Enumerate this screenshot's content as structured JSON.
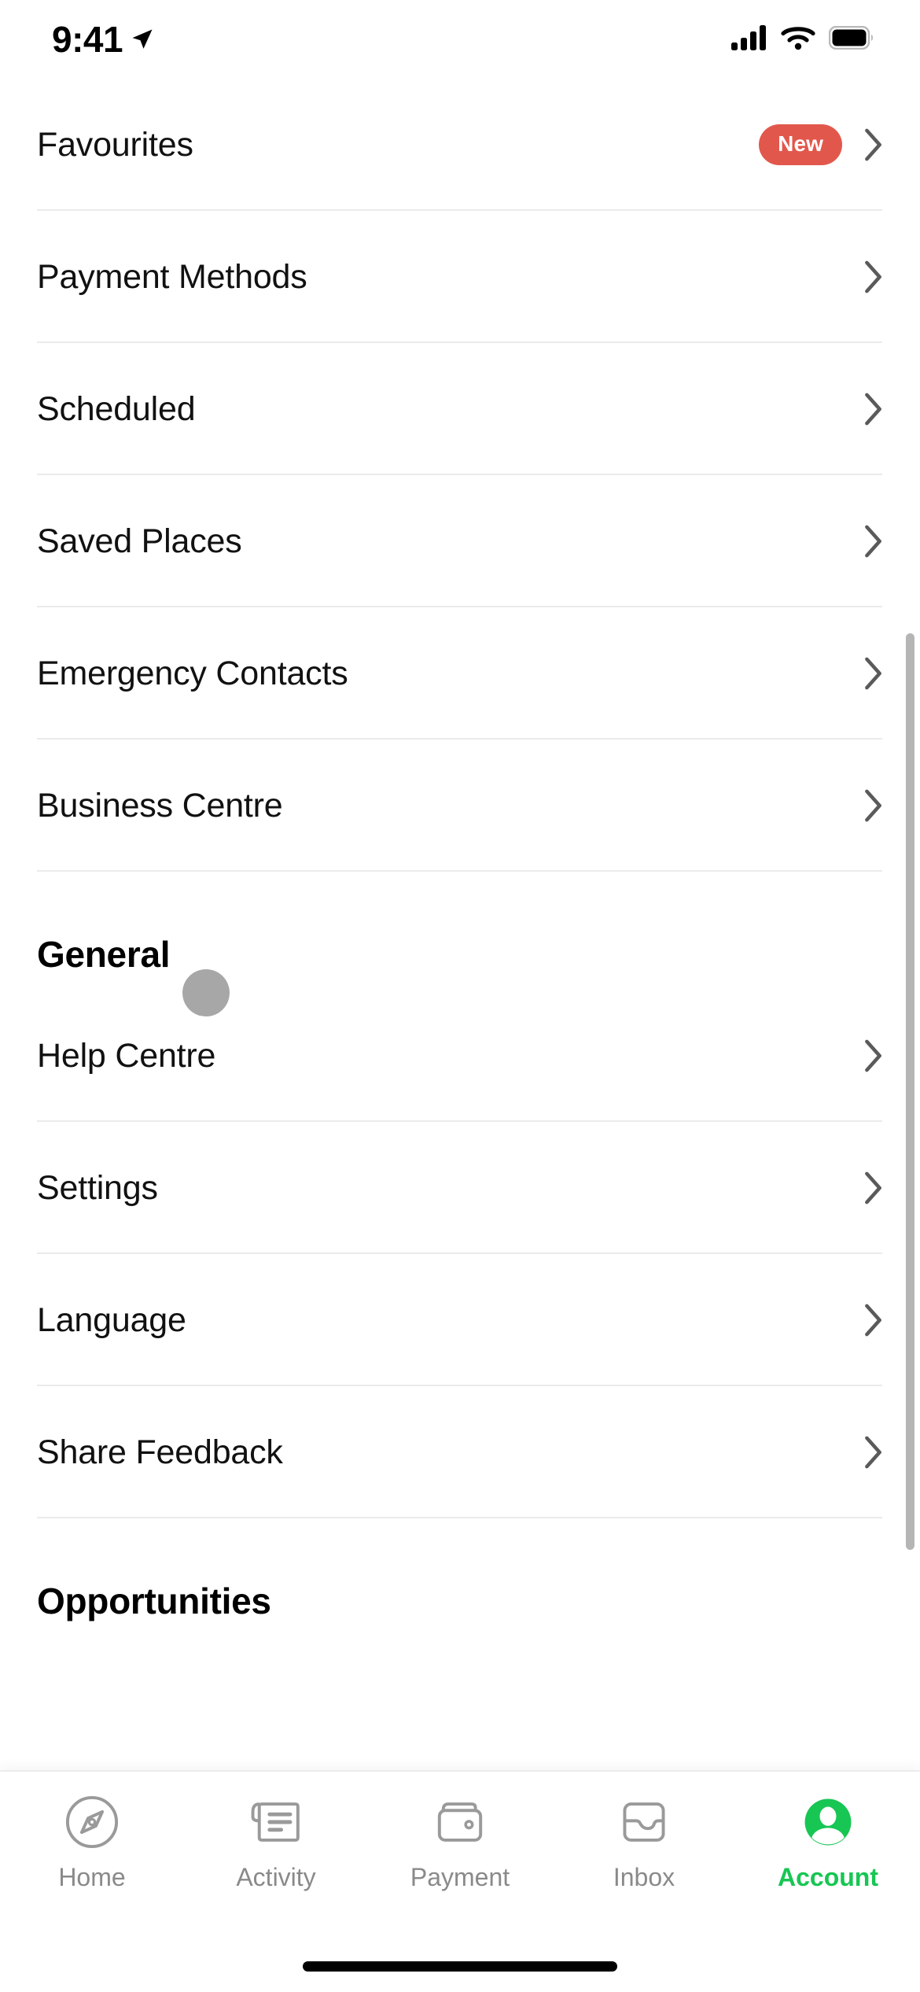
{
  "status_bar": {
    "time": "9:41",
    "location_icon": "location-arrow-icon",
    "signal_icon": "cellular-signal-icon",
    "wifi_icon": "wifi-icon",
    "battery_icon": "battery-full-icon"
  },
  "account_menu": {
    "top_rows": [
      {
        "label": "Favourites",
        "badge": "New",
        "chevron": "chevron-right-icon"
      },
      {
        "label": "Payment Methods",
        "badge": "",
        "chevron": "chevron-right-icon"
      },
      {
        "label": "Scheduled",
        "badge": "",
        "chevron": "chevron-right-icon"
      },
      {
        "label": "Saved Places",
        "badge": "",
        "chevron": "chevron-right-icon"
      },
      {
        "label": "Emergency Contacts",
        "badge": "",
        "chevron": "chevron-right-icon"
      },
      {
        "label": "Business Centre",
        "badge": "",
        "chevron": "chevron-right-icon"
      }
    ],
    "general_section": {
      "title": "General",
      "rows": [
        {
          "label": "Help Centre",
          "chevron": "chevron-right-icon"
        },
        {
          "label": "Settings",
          "chevron": "chevron-right-icon"
        },
        {
          "label": "Language",
          "chevron": "chevron-right-icon"
        },
        {
          "label": "Share Feedback",
          "chevron": "chevron-right-icon"
        }
      ]
    },
    "opportunities_section": {
      "title": "Opportunities"
    }
  },
  "badge_color": "#e2574c",
  "accent_color": "#17c653",
  "tab_bar": {
    "tabs": [
      {
        "label": "Home",
        "icon": "compass-icon",
        "active": false
      },
      {
        "label": "Activity",
        "icon": "receipt-icon",
        "active": false
      },
      {
        "label": "Payment",
        "icon": "wallet-icon",
        "active": false
      },
      {
        "label": "Inbox",
        "icon": "inbox-tray-icon",
        "active": false
      },
      {
        "label": "Account",
        "icon": "person-circle-icon",
        "active": true
      }
    ]
  }
}
